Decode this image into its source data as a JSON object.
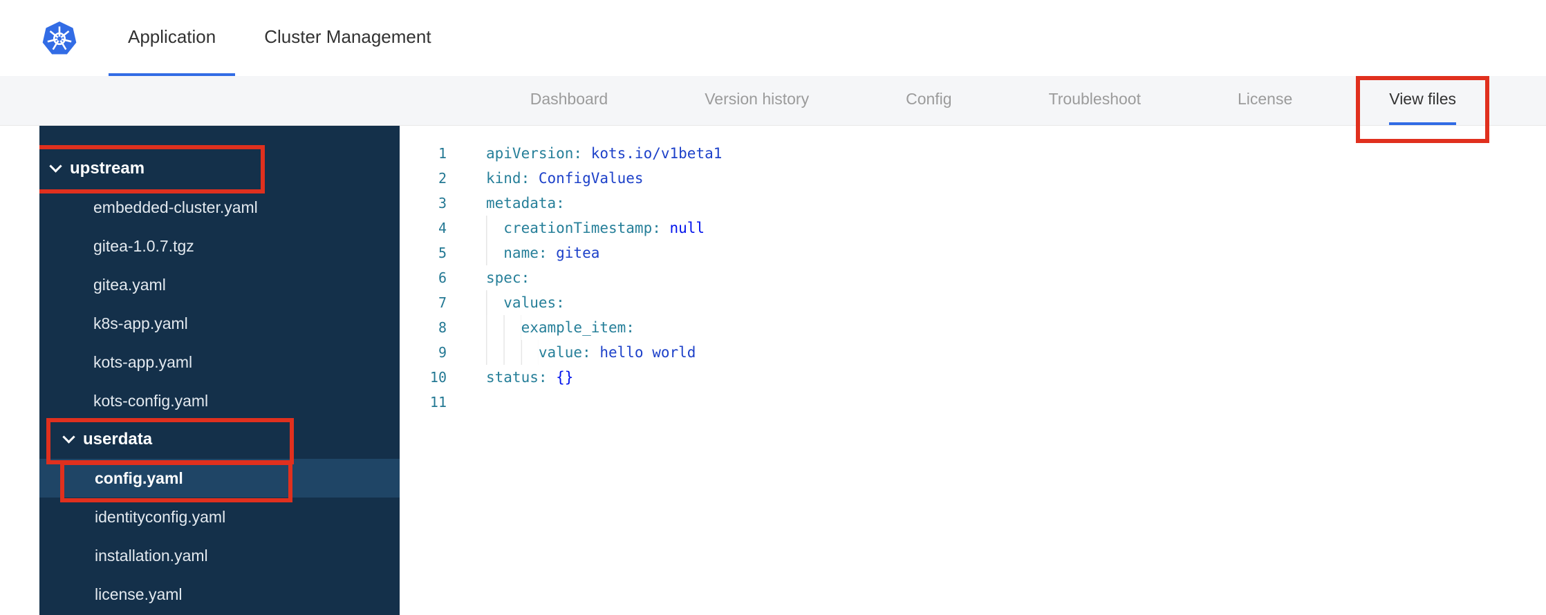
{
  "header": {
    "tabs": [
      {
        "label": "Application",
        "active": true
      },
      {
        "label": "Cluster Management",
        "active": false
      }
    ]
  },
  "subnav": {
    "items": [
      {
        "label": "Dashboard",
        "active": false
      },
      {
        "label": "Version history",
        "active": false
      },
      {
        "label": "Config",
        "active": false
      },
      {
        "label": "Troubleshoot",
        "active": false
      },
      {
        "label": "License",
        "active": false
      },
      {
        "label": "View files",
        "active": true,
        "annotated": true
      }
    ]
  },
  "file_tree": {
    "sections": [
      {
        "label": "upstream",
        "level": 0,
        "expanded": true,
        "annotated": true,
        "files": [
          {
            "name": "embedded-cluster.yaml",
            "level": 1
          },
          {
            "name": "gitea-1.0.7.tgz",
            "level": 1
          },
          {
            "name": "gitea.yaml",
            "level": 1
          },
          {
            "name": "k8s-app.yaml",
            "level": 1
          },
          {
            "name": "kots-app.yaml",
            "level": 1
          },
          {
            "name": "kots-config.yaml",
            "level": 1
          }
        ]
      },
      {
        "label": "userdata",
        "level": 1,
        "expanded": true,
        "annotated": true,
        "files": [
          {
            "name": "config.yaml",
            "level": 2,
            "selected": true,
            "annotated": true
          },
          {
            "name": "identityconfig.yaml",
            "level": 2
          },
          {
            "name": "installation.yaml",
            "level": 2
          },
          {
            "name": "license.yaml",
            "level": 2
          }
        ]
      }
    ]
  },
  "editor": {
    "language": "yaml",
    "lines": [
      {
        "num": 1,
        "segments": [
          {
            "text": "apiVersion:",
            "token": "key"
          },
          {
            "text": " kots.io/v1beta1",
            "token": "str"
          }
        ]
      },
      {
        "num": 2,
        "segments": [
          {
            "text": "kind:",
            "token": "key"
          },
          {
            "text": " ConfigValues",
            "token": "str"
          }
        ]
      },
      {
        "num": 3,
        "segments": [
          {
            "text": "metadata:",
            "token": "key"
          }
        ]
      },
      {
        "num": 4,
        "segments": [
          {
            "text": "  creationTimestamp:",
            "token": "key"
          },
          {
            "text": " null",
            "token": "kw"
          }
        ]
      },
      {
        "num": 5,
        "segments": [
          {
            "text": "  name:",
            "token": "key"
          },
          {
            "text": " gitea",
            "token": "str"
          }
        ]
      },
      {
        "num": 6,
        "segments": [
          {
            "text": "spec:",
            "token": "key"
          }
        ]
      },
      {
        "num": 7,
        "segments": [
          {
            "text": "  values:",
            "token": "key"
          }
        ]
      },
      {
        "num": 8,
        "segments": [
          {
            "text": "    example_item:",
            "token": "key"
          }
        ]
      },
      {
        "num": 9,
        "segments": [
          {
            "text": "      value:",
            "token": "key"
          },
          {
            "text": " hello world",
            "token": "str"
          }
        ]
      },
      {
        "num": 10,
        "segments": [
          {
            "text": "status:",
            "token": "key"
          },
          {
            "text": " {}",
            "token": "kw"
          }
        ]
      },
      {
        "num": 11,
        "segments": []
      }
    ]
  },
  "colors": {
    "accent_blue": "#326ce5",
    "annotation_red": "#e0301e",
    "sidebar_bg": "#14304a",
    "sidebar_selected_bg": "#1f4566",
    "subnav_bg": "#f5f6f8",
    "nav_inactive_text": "#9b9b9b",
    "nav_active_text": "#323232",
    "line_number": "#237893",
    "tok_key": "#267f99",
    "tok_str": "#1d41c9",
    "tok_kw": "#0012ec"
  }
}
